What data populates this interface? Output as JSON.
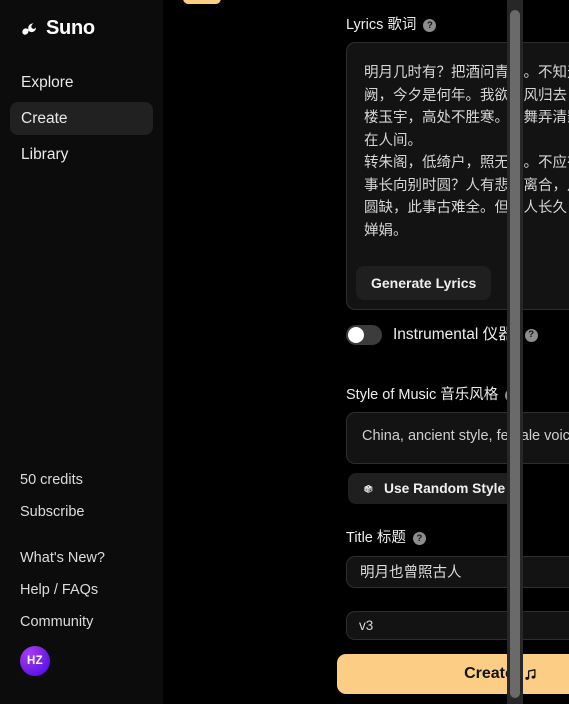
{
  "brand": {
    "name": "Suno",
    "logo_icon": "suno-wave-icon"
  },
  "sidebar": {
    "nav": [
      {
        "label": "Explore",
        "active": false
      },
      {
        "label": "Create",
        "active": true
      },
      {
        "label": "Library",
        "active": false
      }
    ],
    "credits": "50 credits",
    "subscribe": "Subscribe",
    "links": [
      {
        "label": "What's New?"
      },
      {
        "label": "Help / FAQs"
      },
      {
        "label": "Community"
      }
    ],
    "avatar": {
      "initials": "HZ"
    }
  },
  "main": {
    "top_cutoff_text": "",
    "lyrics": {
      "label": "Lyrics 歌词",
      "help_icon": "help-circle-icon",
      "value": "明月几时有？把酒问青天。不知天上宫阙，今夕是何年。我欲乘风归去，又恐琼楼玉宇，高处不胜寒。起舞弄清影，何似在人间。\n转朱阁，低绮户，照无眠。不应有恨，何事长向别时圆？人有悲欢离合，月有阴晴圆缺，此事古难全。但愿人长久，千里共婵娟。",
      "generate_button": "Generate Lyrics"
    },
    "instrumental": {
      "label": "Instrumental 仪器",
      "help_icon": "help-circle-icon",
      "enabled": false
    },
    "style": {
      "label": "Style of Music 音乐风格",
      "help_icon": "help-circle-icon",
      "value": "China, ancient style, female voice",
      "random_button": "Use Random Style",
      "random_icon": "dice-icon"
    },
    "title": {
      "label": "Title 标题",
      "help_icon": "help-circle-icon",
      "value": "明月也曾照古人"
    },
    "model": {
      "selected": "v3",
      "chevron_icon": "chevron-down-icon"
    },
    "create": {
      "label": "Create",
      "icon": "music-note-icon"
    }
  },
  "colors": {
    "accent": "#fcce85",
    "sidebar_bg": "#0c0c0c",
    "panel_bg": "#000000",
    "field_bg": "#131313",
    "field_border": "#2e2e2e"
  }
}
